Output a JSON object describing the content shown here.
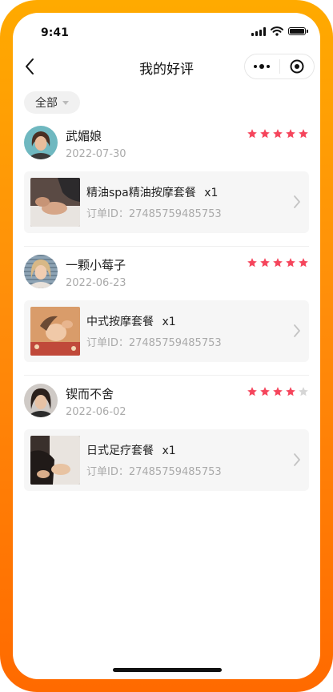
{
  "status": {
    "time": "9:41"
  },
  "nav": {
    "title": "我的好评"
  },
  "filter": {
    "label": "全部"
  },
  "reviews": [
    {
      "user": "武媚娘",
      "date": "2022-07-30",
      "rating": 5,
      "order": {
        "name": "精油spa精油按摩套餐",
        "qty": "x1",
        "id_label": "订单ID：27485759485753"
      }
    },
    {
      "user": "一颗小莓子",
      "date": "2022-06-23",
      "rating": 5,
      "order": {
        "name": "中式按摩套餐",
        "qty": "x1",
        "id_label": "订单ID：27485759485753"
      }
    },
    {
      "user": "锲而不舍",
      "date": "2022-06-02",
      "rating": 4,
      "order": {
        "name": "日式足疗套餐",
        "qty": "x1",
        "id_label": "订单ID：27485759485753"
      }
    }
  ],
  "colors": {
    "star_active": "#f5455c",
    "star_inactive": "#d6d6d6",
    "frame": "#ff8d0a"
  }
}
